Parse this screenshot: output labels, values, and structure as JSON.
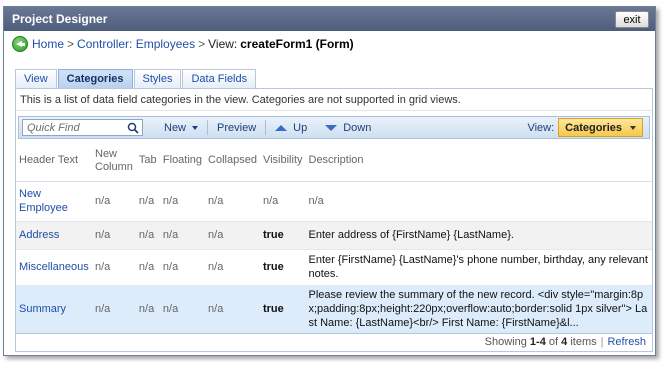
{
  "window": {
    "title": "Project Designer",
    "exit_label": "exit"
  },
  "breadcrumb": {
    "items": [
      "Home",
      "Controller: Employees"
    ],
    "current_prefix": "View:",
    "current": "createForm1 (Form)"
  },
  "tabs": [
    {
      "label": "View",
      "active": false
    },
    {
      "label": "Categories",
      "active": true
    },
    {
      "label": "Styles",
      "active": false
    },
    {
      "label": "Data Fields",
      "active": false
    }
  ],
  "description": "This is a list of data field categories in the view. Categories are not supported in grid views.",
  "toolbar": {
    "quickfind_placeholder": "Quick Find",
    "new_label": "New",
    "preview_label": "Preview",
    "up_label": "Up",
    "down_label": "Down",
    "view_label": "View:",
    "view_value": "Categories"
  },
  "grid": {
    "columns": [
      "Header Text",
      "New Column",
      "Tab",
      "Floating",
      "Collapsed",
      "Visibility",
      "Description"
    ],
    "rows": [
      {
        "header": "New Employee",
        "new_column": "n/a",
        "tab": "n/a",
        "floating": "n/a",
        "collapsed": "n/a",
        "visibility": "n/a",
        "description": "n/a"
      },
      {
        "header": "Address",
        "new_column": "n/a",
        "tab": "n/a",
        "floating": "n/a",
        "collapsed": "n/a",
        "visibility": "true",
        "description": "Enter address of {FirstName} {LastName}."
      },
      {
        "header": "Miscellaneous",
        "new_column": "n/a",
        "tab": "n/a",
        "floating": "n/a",
        "collapsed": "n/a",
        "visibility": "true",
        "description": "Enter {FirstName} {LastName}'s phone number, birthday, any relevant notes."
      },
      {
        "header": "Summary",
        "new_column": "n/a",
        "tab": "n/a",
        "floating": "n/a",
        "collapsed": "n/a",
        "visibility": "true",
        "description": "Please review the summary of the new record. <div style=\"margin:8px;padding:8px;height:220px;overflow:auto;border:solid 1px silver\"> Last Name: {LastName}<br/> First Name: {FirstName}&l..."
      }
    ]
  },
  "footer": {
    "showing_prefix": "Showing",
    "range": "1-4",
    "of_word": "of",
    "total": "4",
    "items_word": "items",
    "refresh_label": "Refresh"
  }
}
